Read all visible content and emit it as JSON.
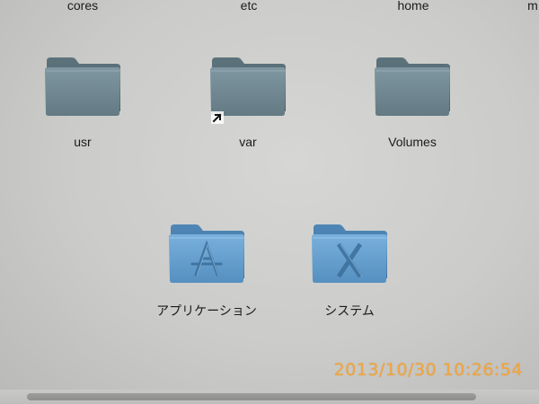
{
  "top_row": {
    "items": [
      {
        "label": "cores"
      },
      {
        "label": "etc"
      },
      {
        "label": "home"
      },
      {
        "label": "m"
      }
    ]
  },
  "folders": [
    {
      "label": "usr",
      "icon": "folder-icon"
    },
    {
      "label": "var",
      "icon": "folder-alias-icon"
    },
    {
      "label": "Volumes",
      "icon": "folder-icon"
    },
    {
      "label": "アプリケーション",
      "icon": "applications-folder-icon"
    },
    {
      "label": "システム",
      "icon": "system-folder-icon"
    }
  ],
  "photo_timestamp": "2013/10/30 10:26:54",
  "colors": {
    "background": "#cbcbc9",
    "plain_folder": "#6f8791",
    "blue_folder": "#5f96c4",
    "timestamp": "#f0a640"
  }
}
